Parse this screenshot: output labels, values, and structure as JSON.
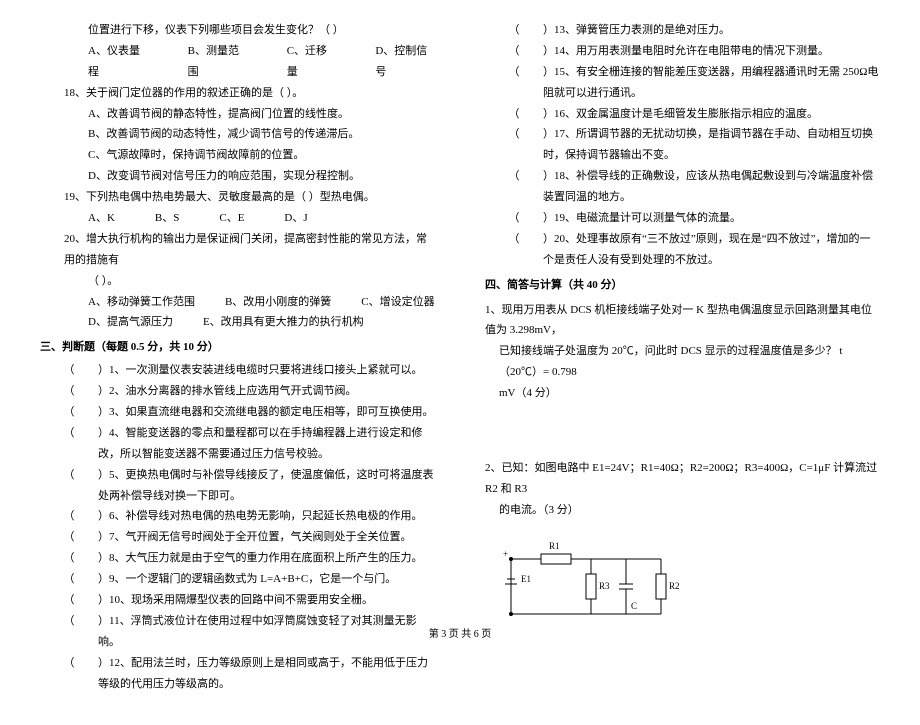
{
  "left": {
    "q17_cont": {
      "line": "位置进行下移，仪表下列哪些项目会发生变化？（        ）",
      "opts": [
        "A、仪表量程",
        "B、测量范围",
        "C、迁移量",
        "D、控制信号"
      ]
    },
    "q18": {
      "stem": "18、关于阀门定位器的作用的叙述正确的是（        ）。",
      "opts": [
        "A、改善调节阀的静态特性，提高阀门位置的线性度。",
        "B、改善调节阀的动态特性，减少调节信号的传递滞后。",
        "C、气源故障时，保持调节阀故障前的位置。",
        "D、改变调节阀对信号压力的响应范围，实现分程控制。"
      ]
    },
    "q19": {
      "stem": "19、下列热电偶中热电势最大、灵敏度最高的是（        ）型热电偶。",
      "opts": [
        "A、K",
        "B、S",
        "C、E",
        "D、J"
      ]
    },
    "q20": {
      "stem": "20、增大执行机构的输出力是保证阀门关闭，提高密封性能的常见方法，常用的措施有",
      "stem2": "（        ）。",
      "opts": [
        "A、移动弹簧工作范围",
        "B、改用小刚度的弹簧",
        "C、增设定位器"
      ],
      "opts2": [
        "D、提高气源压力",
        "E、改用具有更大推力的执行机构"
      ]
    },
    "sec3_title": "三、判断题（每题 0.5 分，共 10 分）",
    "judges": [
      "）1、一次测量仪表安装进线电缆时只要将进线口接头上紧就可以。",
      "）2、油水分离器的排水管线上应选用气开式调节阀。",
      "）3、如果直流继电器和交流继电器的额定电压相等，即可互换使用。",
      "）4、智能变送器的零点和量程都可以在手持编程器上进行设定和修改，所以智能变送器不需要通过压力信号校验。",
      "）5、更换热电偶时与补偿导线接反了，使温度偏低，这时可将温度表处两补偿导线对换一下即可。",
      "）6、补偿导线对热电偶的热电势无影响，只起延长热电极的作用。",
      "）7、气开阀无信号时阀处于全开位置，气关阀则处于全关位置。",
      "）8、大气压力就是由于空气的重力作用在底面积上所产生的压力。",
      "）9、一个逻辑门的逻辑函数式为 L=A+B+C，它是一个与门。",
      "）10、现场采用隔爆型仪表的回路中间不需要用安全栅。",
      "）11、浮筒式液位计在使用过程中如浮筒腐蚀变轻了对其测量无影响。",
      "）12、配用法兰时，压力等级原则上是相同或高于，不能用低于压力等级的代用压力等级高的。"
    ]
  },
  "right": {
    "judges": [
      "）13、弹簧管压力表测的是绝对压力。",
      "）14、用万用表测量电阻时允许在电阻带电的情况下测量。",
      "）15、有安全栅连接的智能差压变送器，用编程器通讯时无需 250Ω电阻就可以进行通讯。",
      "）16、双金属温度计是毛细管发生膨胀指示相应的温度。",
      "）17、所谓调节器的无扰动切换，是指调节器在手动、自动相互切换时，保持调节器输出不变。",
      "）18、补偿导线的正确敷设，应该从热电偶起敷设到与冷端温度补偿装置同温的地方。",
      "）19、电磁流量计可以测量气体的流量。",
      "）20、处理事故原有“三不放过”原则，现在是“四不放过”，增加的一个是责任人没有受到处理的不放过。"
    ],
    "sec4_title": "四、简答与计算（共 40 分）",
    "q4_1": {
      "line1": "1、现用万用表从 DCS 机柜接线端子处对一 K 型热电偶温度显示回路测量其电位值为 3.298mV，",
      "line2": "已知接线端子处温度为 20℃，问此时 DCS 显示的过程温度值是多少？   t（20℃）= 0.798",
      "line3": "mV（4 分）"
    },
    "q4_2": {
      "line1": "2、已知：如图电路中 E1=24V；R1=40Ω；R2=200Ω；R3=400Ω，C=1μF 计算流过 R2 和 R3",
      "line2": "的电流。（3 分）"
    },
    "circuit_labels": {
      "r1": "R1",
      "r2": "R2",
      "r3": "R3",
      "e1": "E1",
      "c": "C"
    }
  },
  "footer": "第 3 页 共 6 页"
}
